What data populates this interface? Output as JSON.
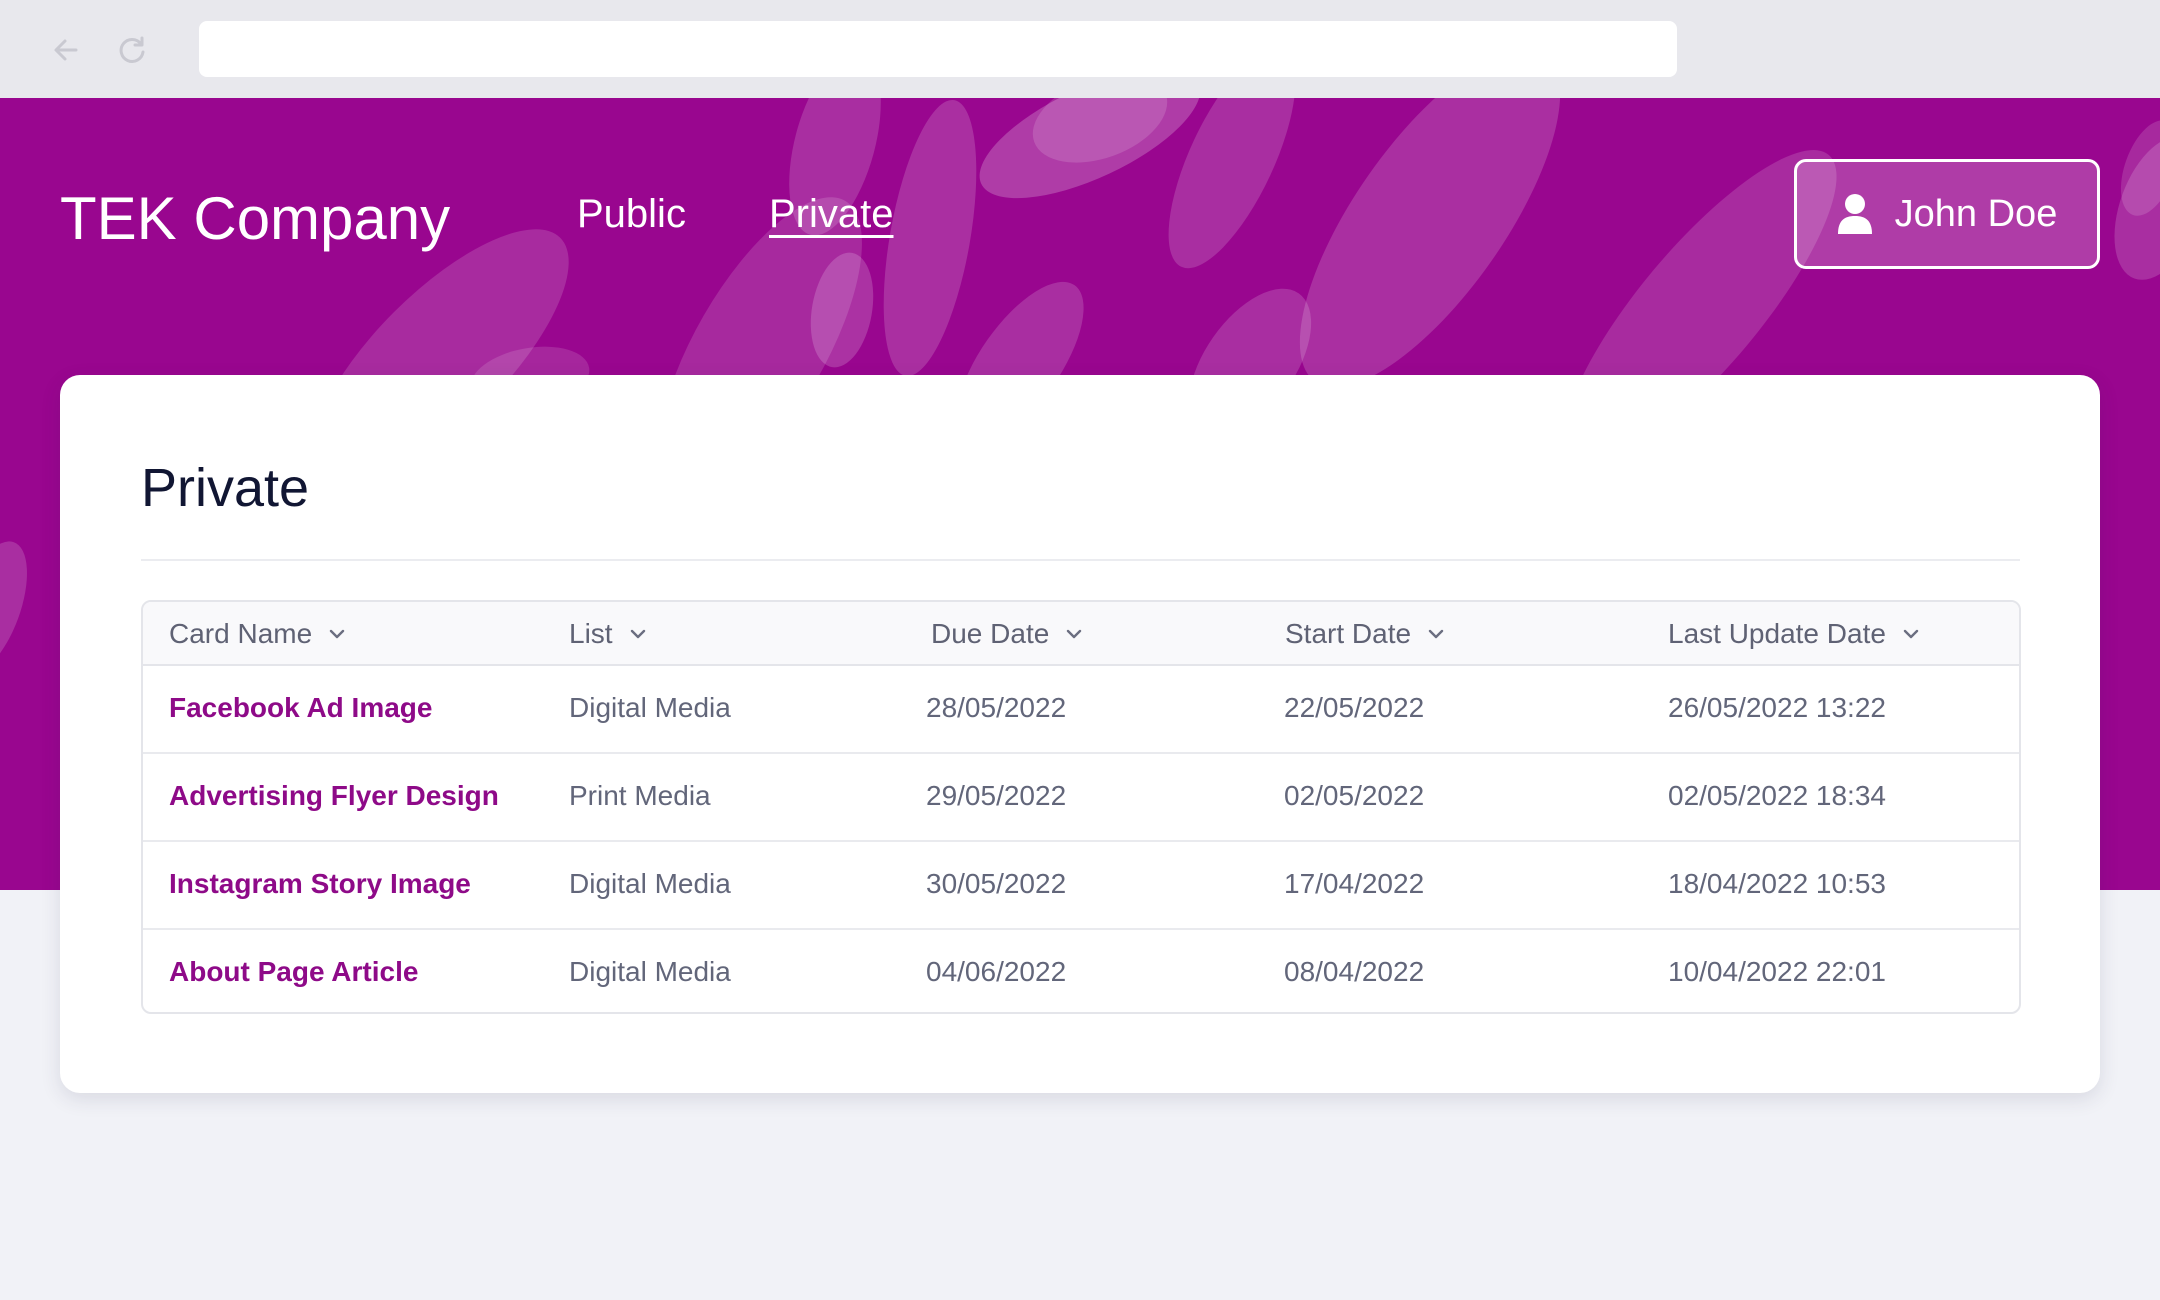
{
  "browser": {
    "back_icon": "arrow-left-icon",
    "reload_icon": "reload-icon",
    "address": ""
  },
  "header": {
    "brand": "TEK Company",
    "nav": [
      {
        "label": "Public"
      },
      {
        "label": "Private"
      }
    ],
    "active_nav": "Private",
    "user": {
      "name": "John Doe",
      "icon": "user-icon"
    },
    "background_color": "#99068f"
  },
  "page": {
    "title": "Private"
  },
  "table": {
    "columns": [
      {
        "label": "Card Name",
        "icon": "chevron-down-icon"
      },
      {
        "label": "List",
        "icon": "chevron-down-icon"
      },
      {
        "label": "Due Date",
        "icon": "chevron-down-icon"
      },
      {
        "label": "Start Date",
        "icon": "chevron-down-icon"
      },
      {
        "label": "Last Update Date",
        "icon": "chevron-down-icon"
      }
    ],
    "rows": [
      {
        "name": "Facebook Ad Image",
        "list": "Digital Media",
        "due": "28/05/2022",
        "start": "22/05/2022",
        "updated": "26/05/2022 13:22"
      },
      {
        "name": "Advertising Flyer Design",
        "list": "Print Media",
        "due": "29/05/2022",
        "start": "02/05/2022",
        "updated": "02/05/2022 18:34"
      },
      {
        "name": "Instagram Story Image",
        "list": "Digital Media",
        "due": "30/05/2022",
        "start": "17/04/2022",
        "updated": "18/04/2022 10:53"
      },
      {
        "name": "About Page Article",
        "list": "Digital Media",
        "due": "04/06/2022",
        "start": "08/04/2022",
        "updated": "10/04/2022 22:01"
      }
    ]
  },
  "colors": {
    "accent": "#8e0a88",
    "page_background": "#f1f2f7",
    "card_background": "#ffffff"
  }
}
